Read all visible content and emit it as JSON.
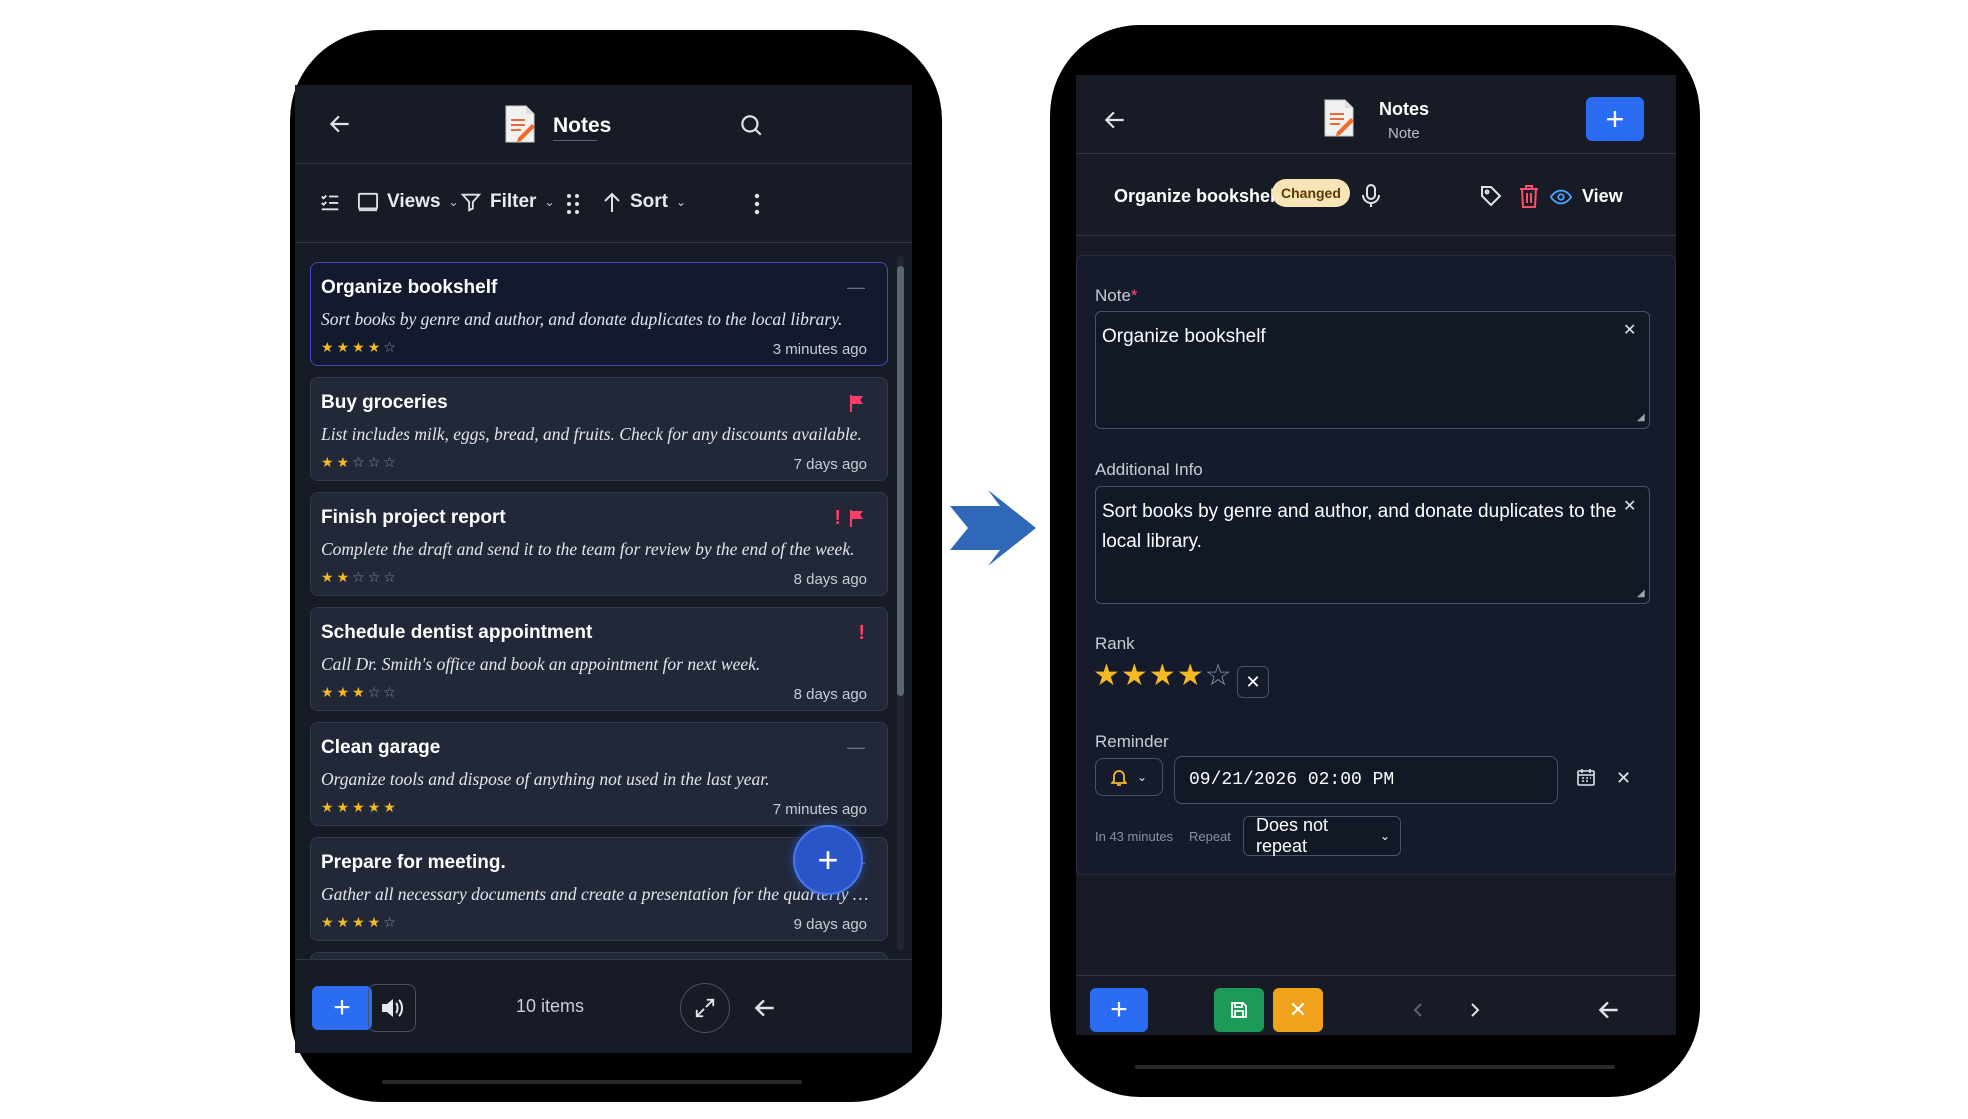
{
  "left": {
    "header": {
      "title": "Notes",
      "back_icon": "arrow-left-icon",
      "search_icon": "search-icon"
    },
    "toolbar": {
      "views_label": "Views",
      "filter_label": "Filter",
      "sort_label": "Sort"
    },
    "cards": [
      {
        "title": "Organize bookshelf",
        "desc": "Sort books by genre and author, and donate duplicates to the local library.",
        "rating": 4,
        "time": "3 minutes ago",
        "flag": false,
        "important": false
      },
      {
        "title": "Buy groceries",
        "desc": "List includes milk, eggs, bread, and fruits. Check for any discounts available.",
        "rating": 2,
        "time": "7 days ago",
        "flag": true,
        "important": false
      },
      {
        "title": "Finish project report",
        "desc": "Complete the draft and send it to the team for review by the end of the week.",
        "rating": 2,
        "time": "8 days ago",
        "flag": true,
        "important": true
      },
      {
        "title": "Schedule dentist appointment",
        "desc": "Call Dr. Smith's office and book an appointment for next week.",
        "rating": 3,
        "time": "8 days ago",
        "flag": false,
        "important": true
      },
      {
        "title": "Clean garage",
        "desc": "Organize tools and dispose of anything not used in the last year.",
        "rating": 5,
        "time": "7 minutes ago",
        "flag": false,
        "important": false
      },
      {
        "title": "Prepare for meeting.",
        "desc": "Gather all necessary documents and create a presentation for the quarterly review.",
        "rating": 4,
        "time": "9 days ago",
        "flag": false,
        "important": false
      }
    ],
    "footer": {
      "count": "10 items"
    }
  },
  "right": {
    "header": {
      "title": "Notes",
      "subtitle": "Note"
    },
    "record": {
      "name": "Organize bookshelf",
      "badge": "Changed",
      "view_label": "View"
    },
    "form": {
      "note_label": "Note",
      "note_required": "*",
      "note_value": "Organize bookshelf",
      "info_label": "Additional Info",
      "info_value": "Sort books by genre and author, and donate duplicates to the local library.",
      "rank_label": "Rank",
      "rank_value": 4,
      "rank_max": 5,
      "reminder_label": "Reminder",
      "reminder_value": "09/21/2026 02:00 PM",
      "in_text": "In 43 minutes",
      "repeat_label": "Repeat",
      "repeat_value": "Does not repeat"
    }
  },
  "colors": {
    "accent_blue": "#2a6cf2",
    "star": "#f5b923",
    "flag": "#ff3d68",
    "save_green": "#1b9a58",
    "cancel_orange": "#f0a21a",
    "badge_bg": "#f8e5b7"
  }
}
